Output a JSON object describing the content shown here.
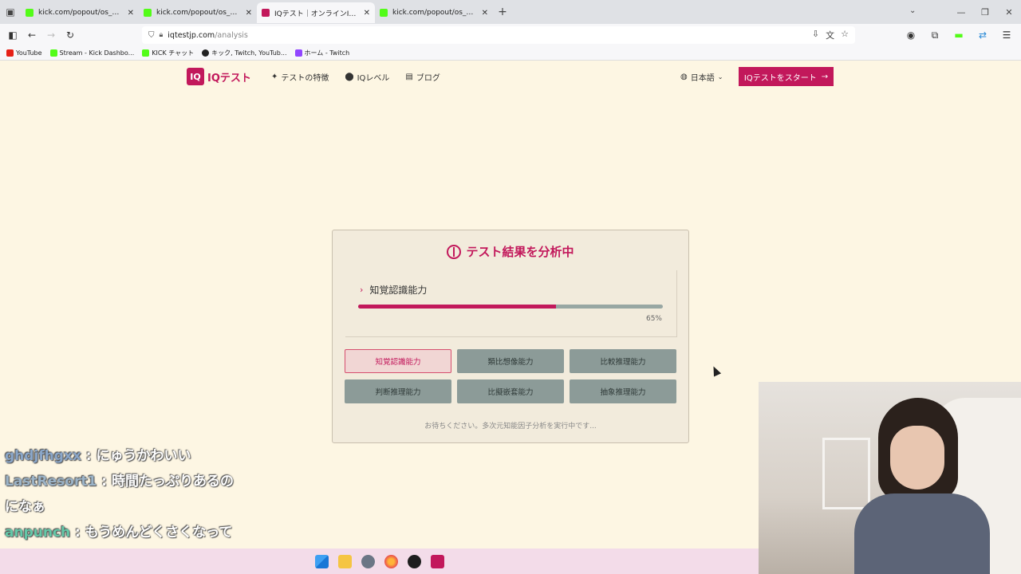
{
  "browser": {
    "tabs": [
      {
        "title": "kick.com/popout/os_new/chat",
        "icon": "kick",
        "active": false
      },
      {
        "title": "kick.com/popout/os_new/chat",
        "icon": "kick",
        "active": false
      },
      {
        "title": "IQテスト｜オンラインIQ診断・知能",
        "icon": "iq",
        "active": true
      },
      {
        "title": "kick.com/popout/os_new/chat",
        "icon": "kick",
        "active": false
      }
    ],
    "url_host": "iqtestjp.com",
    "url_path": "/analysis",
    "bookmarks": [
      {
        "label": "YouTube",
        "color": "#e62117"
      },
      {
        "label": "Stream - Kick Dashbo...",
        "color": "#53fc18"
      },
      {
        "label": "KICK チャット",
        "color": "#53fc18"
      },
      {
        "label": "キック, Twitch, YouTub...",
        "color": "#222222"
      },
      {
        "label": "ホーム - Twitch",
        "color": "#9146ff"
      }
    ]
  },
  "site": {
    "logo_mark": "IQ",
    "logo_text": "IQテスト",
    "nav": [
      {
        "label": "テストの特徴",
        "icon": "sparkle-icon"
      },
      {
        "label": "IQレベル",
        "icon": "pin-icon"
      },
      {
        "label": "ブログ",
        "icon": "book-icon"
      }
    ],
    "language": "日本語",
    "cta": "IQテストをスタート",
    "accent": "#c2185b"
  },
  "analysis": {
    "title": "テスト結果を分析中",
    "current_ability": "知覚認識能力",
    "progress_percent": 65,
    "progress_label": "65%",
    "abilities": [
      {
        "label": "知覚認識能力",
        "active": true
      },
      {
        "label": "類比想像能力",
        "active": false
      },
      {
        "label": "比較推理能力",
        "active": false
      },
      {
        "label": "判断推理能力",
        "active": false
      },
      {
        "label": "比擬嵌套能力",
        "active": false
      },
      {
        "label": "抽象推理能力",
        "active": false
      }
    ],
    "wait_message": "お待ちください。多次元知能因子分析を実行中です..."
  },
  "chat": [
    {
      "user": "ghdjfhgxx",
      "text": "にゅうかわいい"
    },
    {
      "user": "LastResort1",
      "text": "時間たっぷりあるのになぁ"
    },
    {
      "user": "anpunch",
      "text": "もうめんどくさくなってる"
    }
  ]
}
